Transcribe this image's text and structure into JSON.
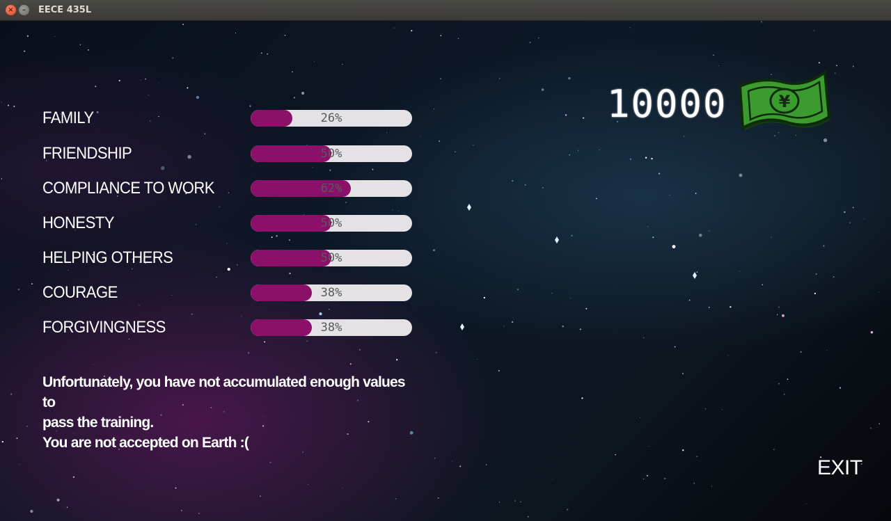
{
  "window": {
    "title": "EECE 435L",
    "close_glyph": "×",
    "minimize_glyph": "–"
  },
  "values": [
    {
      "label": "FAMILY",
      "percent": 26,
      "display": "26%"
    },
    {
      "label": "FRIENDSHIP",
      "percent": 50,
      "display": "50%"
    },
    {
      "label": "COMPLIANCE TO WORK",
      "percent": 62,
      "display": "62%"
    },
    {
      "label": "HONESTY",
      "percent": 50,
      "display": "50%"
    },
    {
      "label": "HELPING OTHERS",
      "percent": 50,
      "display": "50%"
    },
    {
      "label": "COURAGE",
      "percent": 38,
      "display": "38%"
    },
    {
      "label": "FORGIVINGNESS",
      "percent": 38,
      "display": "38%"
    }
  ],
  "money": {
    "amount": "10000",
    "icon": "money-bill-icon",
    "currency_symbol": "¥"
  },
  "message": {
    "lines": [
      "Unfortunately, you have not accumulated enough values",
      "to",
      "pass the training.",
      "You are not accepted on Earth :("
    ]
  },
  "exit": {
    "label": "EXIT"
  },
  "colors": {
    "bar_fill": "#8c0f6a",
    "bar_track": "#e4e2e4",
    "bill_green": "#3c9b2f",
    "text": "#ffffff"
  }
}
